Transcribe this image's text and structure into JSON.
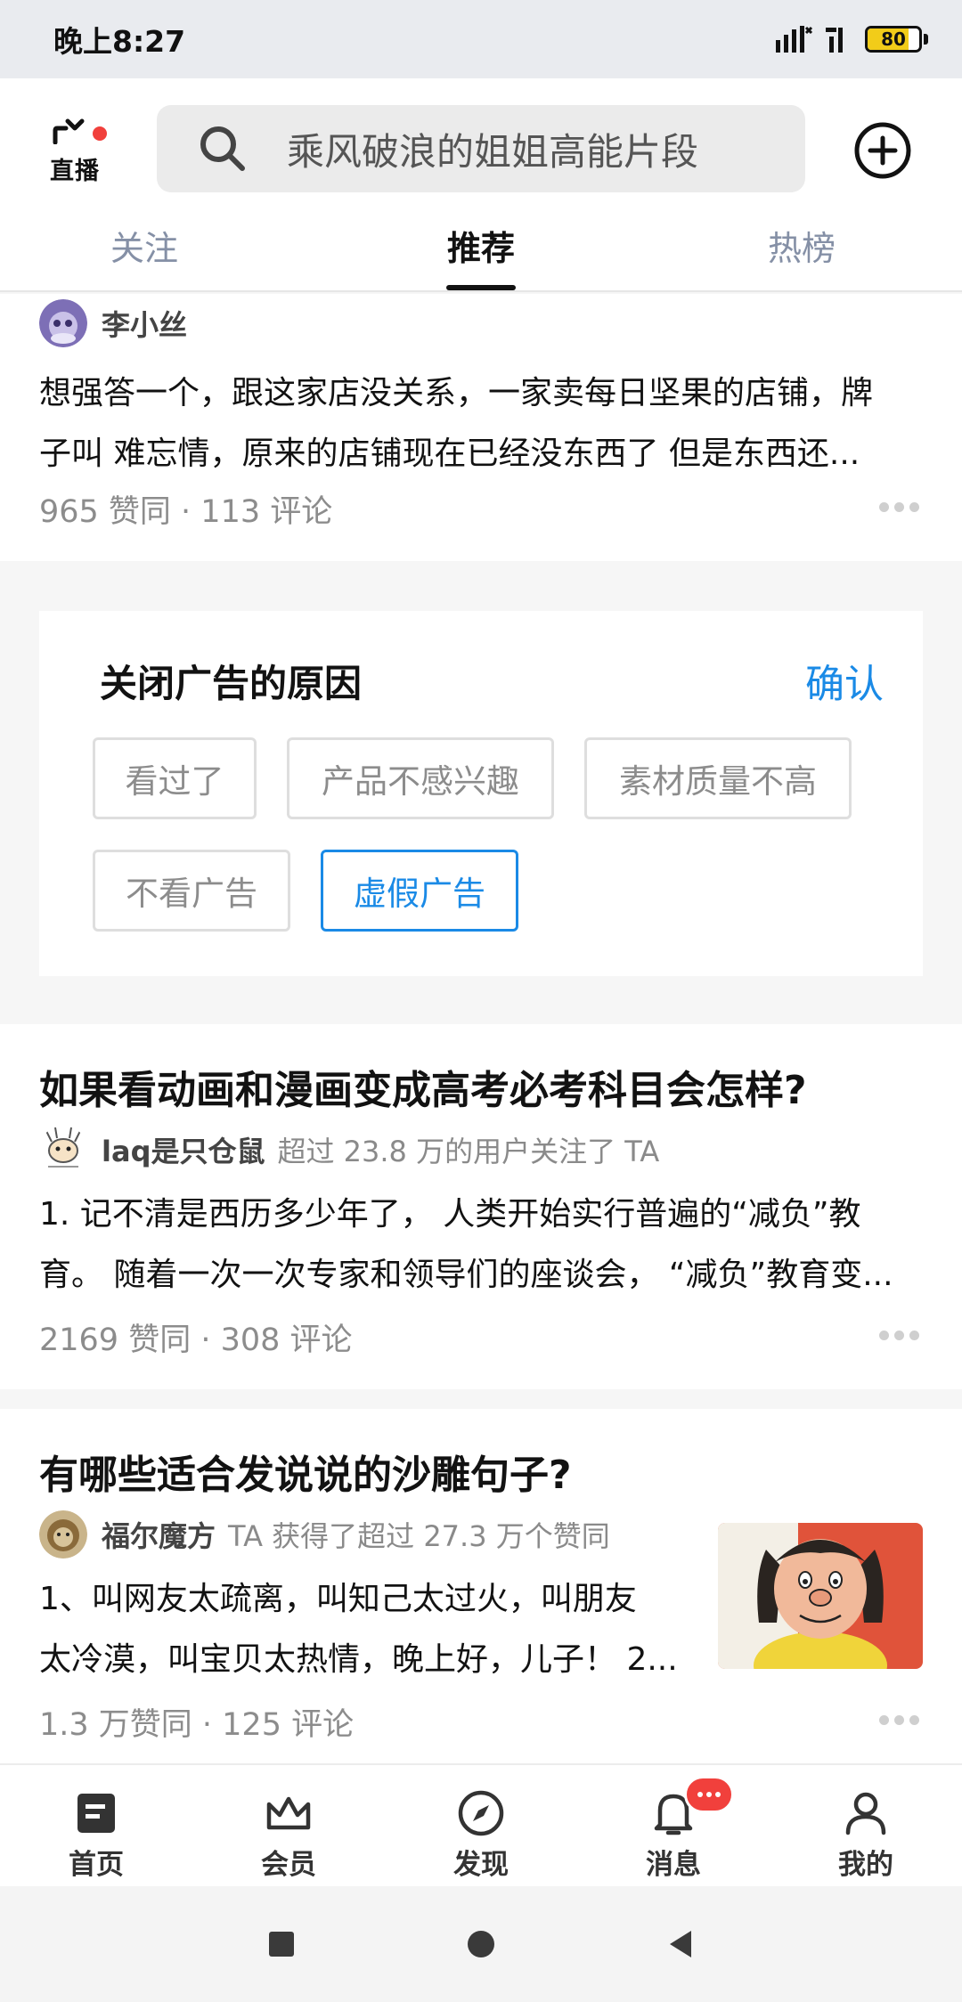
{
  "status_bar": {
    "time": "晚上8:27",
    "battery_level": "80"
  },
  "header": {
    "live_label": "直播",
    "search_placeholder": "乘风破浪的姐姐高能片段"
  },
  "tabs": [
    {
      "label": "关注",
      "active": false
    },
    {
      "label": "推荐",
      "active": true
    },
    {
      "label": "热榜",
      "active": false
    }
  ],
  "feed": {
    "card1": {
      "author": "李小丝",
      "lines": [
        "想强答一个，跟这家店没关系，一家卖每日坚果的店铺，牌",
        "子叫 难忘情，原来的店铺现在已经没东西了 但是东西还..."
      ],
      "stats": "965 赞同 · 113 评论"
    },
    "ad_close": {
      "title": "关闭广告的原因",
      "confirm": "确认",
      "reasons": [
        "看过了",
        "产品不感兴趣",
        "素材质量不高",
        "不看广告",
        "虚假广告"
      ],
      "selected_reason": "虚假广告"
    },
    "card3": {
      "title": "如果看动画和漫画变成高考必考科目会怎样?",
      "author": "laq是只仓鼠",
      "author_meta": "超过 23.8 万的用户关注了 TA",
      "lines": [
        "1. 记不清是西历多少年了， 人类开始实行普遍的“减负”教",
        "育。 随着一次一次专家和领导们的座谈会， “减负”教育变..."
      ],
      "stats": "2169 赞同 · 308 评论"
    },
    "card4": {
      "title": "有哪些适合发说说的沙雕句子?",
      "author": "福尔魔方",
      "author_meta": "TA 获得了超过 27.3 万个赞同",
      "lines": [
        "1、叫网友太疏离，叫知己太过火，叫朋友",
        "太冷漠，叫宝贝太热情，晚上好，儿子！ 2..."
      ],
      "stats": "1.3 万赞同 · 125 评论"
    }
  },
  "bottom_nav": [
    {
      "label": "首页",
      "icon": "home-doc-icon"
    },
    {
      "label": "会员",
      "icon": "crown-icon"
    },
    {
      "label": "发现",
      "icon": "compass-icon"
    },
    {
      "label": "消息",
      "icon": "bell-icon"
    },
    {
      "label": "我的",
      "icon": "user-icon"
    }
  ],
  "colors": {
    "accent": "#1a8ae6",
    "badge": "#f1403c",
    "battery": "#f2cc19"
  }
}
